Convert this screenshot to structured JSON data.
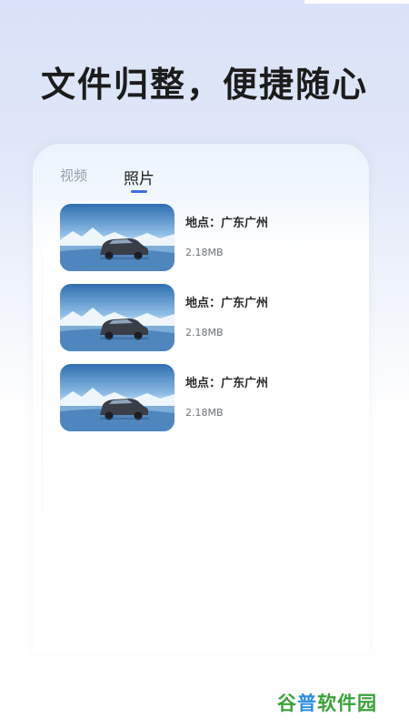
{
  "headline": "文件归整，便捷随心",
  "tabs": [
    {
      "label": "视频",
      "active": false
    },
    {
      "label": "照片",
      "active": true
    }
  ],
  "accent_color": "#3f6fe0",
  "items": [
    {
      "location": "地点：广东广州",
      "size": "2.18MB",
      "thumbnail": "car-photo"
    },
    {
      "location": "地点：广东广州",
      "size": "2.18MB",
      "thumbnail": "car-photo"
    },
    {
      "location": "地点：广东广州",
      "size": "2.18MB",
      "thumbnail": "car-photo"
    }
  ],
  "watermark": {
    "part1": "谷",
    "part2": "普",
    "part3": "软件园"
  }
}
